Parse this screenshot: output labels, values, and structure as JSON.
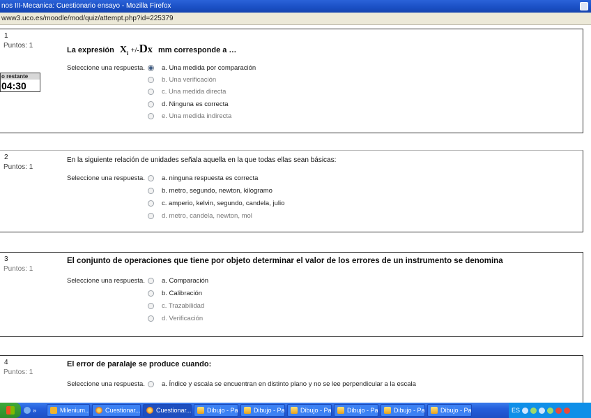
{
  "window": {
    "title": "nos III-Mecanica: Cuestionario ensayo - Mozilla Firefox",
    "url": "www3.uco.es/moodle/mod/quiz/attempt.php?id=225379"
  },
  "timer": {
    "label": "o restante",
    "value": "04:30"
  },
  "prompt": "Seleccione una respuesta.",
  "questions": [
    {
      "number": "1",
      "points": "Puntos: 1",
      "text_pre": "La expresión",
      "formula_x": "X",
      "formula_sub": "i",
      "formula_pm": "+/-",
      "formula_d": "D",
      "formula_dx": "x",
      "text_post": "mm corresponde a …",
      "options": [
        "a. Una medida por comparación",
        "b. Una verificación",
        "c. Una medida directa",
        "d. Ninguna es correcta",
        "e. Una medida indirecta"
      ]
    },
    {
      "number": "2",
      "points": "Puntos: 1",
      "text": "En la siguiente relación de unidades señala aquella en la que todas ellas sean básicas:",
      "options": [
        "a. ninguna respuesta es correcta",
        "b. metro, segundo, newton, kilogramo",
        "c. amperio, kelvin, segundo, candela, julio",
        "d. metro, candela, newton, mol"
      ]
    },
    {
      "number": "3",
      "points": "Puntos: 1",
      "text": "El conjunto de operaciones que tiene por objeto determinar el valor de los errores de un instrumento se denomina",
      "options": [
        "a. Comparación",
        "b. Calibración",
        "c. Trazabilidad",
        "d. Verificación"
      ]
    },
    {
      "number": "4",
      "points": "Puntos: 1",
      "text": "El error de paralaje se produce cuando:",
      "options": [
        "a. Índice y escala se encuentran en distinto plano y no se lee perpendicular a la escala"
      ]
    }
  ],
  "taskbar": {
    "quicklaunch_more": "»",
    "tasks": [
      "Milenium...",
      "Cuestionar...",
      "Cuestionar...",
      "Dibujo - Pa...",
      "Dibujo - Pa...",
      "Dibujo - Pa...",
      "Dibujo - Pa...",
      "Dibujo - Pa...",
      "Dibujo - Pa..."
    ],
    "lang": "ES"
  }
}
